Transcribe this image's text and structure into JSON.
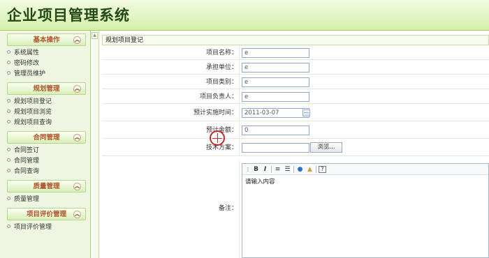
{
  "app": {
    "title": "企业项目管理系统"
  },
  "sidebar": {
    "toggle_icon": "chevron-up-icon",
    "sections": [
      {
        "title": "基本操作",
        "items": [
          "系统属性",
          "密码修改",
          "管理员维护"
        ]
      },
      {
        "title": "规划管理",
        "items": [
          "规划项目登记",
          "规划项目浏览",
          "规划项目查询"
        ]
      },
      {
        "title": "合同管理",
        "items": [
          "合同签订",
          "合同管理",
          "合同查询"
        ]
      },
      {
        "title": "质量管理",
        "items": [
          "质量管理"
        ]
      },
      {
        "title": "项目评价管理",
        "items": [
          "项目评价管理"
        ]
      }
    ]
  },
  "main": {
    "panel_title": "规划项目登记",
    "form": {
      "project_name": {
        "label": "项目名称：",
        "value": "e"
      },
      "undertaking_unit": {
        "label": "承担单位：",
        "value": "e"
      },
      "project_type": {
        "label": "项目类别：",
        "value": "e"
      },
      "project_leader": {
        "label": "项目负责人：",
        "value": "e"
      },
      "plan_date": {
        "label": "预计实施时间：",
        "value": "2011-03-07"
      },
      "plan_amount": {
        "label": "预计金额：",
        "value": "0"
      },
      "tech_plan": {
        "label": "技术方案：",
        "value": "",
        "browse_label": "浏览..."
      },
      "remarks": {
        "label": "备注：",
        "placeholder": "请输入内容"
      }
    },
    "editor_toolbar": [
      "B",
      "I",
      "≡",
      "☰",
      "●",
      "▲",
      "?"
    ]
  }
}
